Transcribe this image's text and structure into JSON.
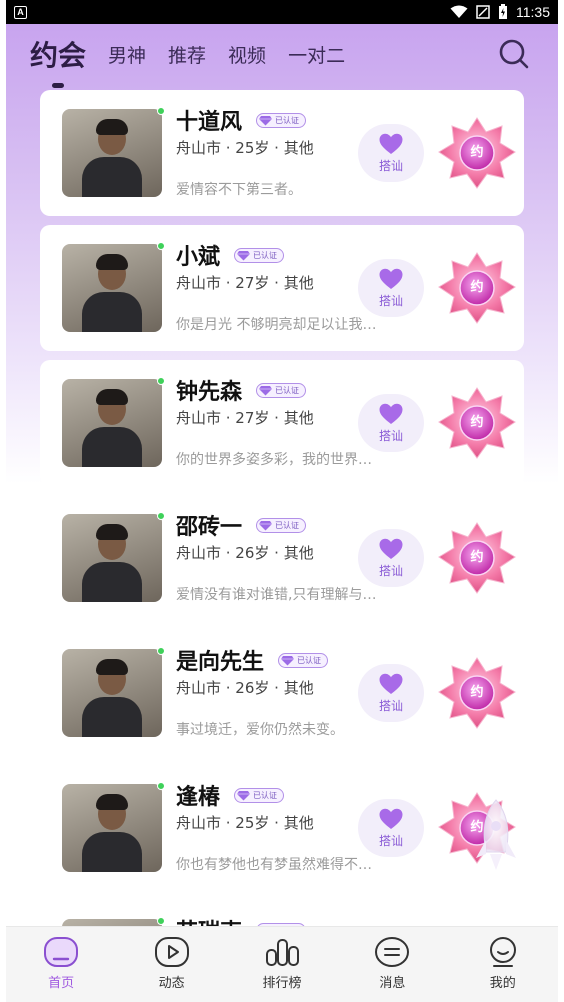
{
  "status_bar": {
    "app_badge": "A",
    "time": "11:35"
  },
  "top_nav": {
    "tabs": [
      {
        "label": "约会",
        "active": true
      },
      {
        "label": "男神",
        "active": false
      },
      {
        "label": "推荐",
        "active": false
      },
      {
        "label": "视频",
        "active": false
      },
      {
        "label": "一对二",
        "active": false
      }
    ],
    "search_icon": "search-icon"
  },
  "cards": [
    {
      "name": "十道风",
      "verified_label": "已认证",
      "meta": "舟山市 · 25岁 · 其他",
      "bio": "爱情容不下第三者。",
      "greet_label": "搭讪",
      "date_label": "约",
      "online": true
    },
    {
      "name": "小斌",
      "verified_label": "已认证",
      "meta": "舟山市 · 27岁 · 其他",
      "bio": "你是月光 不够明亮却足以让我…",
      "greet_label": "搭讪",
      "date_label": "约",
      "online": true
    },
    {
      "name": "钟先森",
      "verified_label": "已认证",
      "meta": "舟山市 · 27岁 · 其他",
      "bio": "你的世界多姿多彩，我的世界…",
      "greet_label": "搭讪",
      "date_label": "约",
      "online": true
    },
    {
      "name": "邵砖一",
      "verified_label": "已认证",
      "meta": "舟山市 · 26岁 · 其他",
      "bio": "爱情没有谁对谁错,只有理解与…",
      "greet_label": "搭讪",
      "date_label": "约",
      "online": true
    },
    {
      "name": "是向先生",
      "verified_label": "已认证",
      "meta": "舟山市 · 26岁 · 其他",
      "bio": "事过境迁，爱你仍然未变。",
      "greet_label": "搭讪",
      "date_label": "约",
      "online": true
    },
    {
      "name": "逢椿",
      "verified_label": "已认证",
      "meta": "舟山市 · 25岁 · 其他",
      "bio": "你也有梦他也有梦虽然难得不…",
      "greet_label": "搭讪",
      "date_label": "约",
      "online": true
    },
    {
      "name": "艾瑞克",
      "verified_label": "已认证",
      "meta": "",
      "bio": "",
      "greet_label": "",
      "date_label": "",
      "online": true
    }
  ],
  "bottom_nav": [
    {
      "label": "首页",
      "icon": "home-icon",
      "active": true
    },
    {
      "label": "动态",
      "icon": "play-icon",
      "active": false
    },
    {
      "label": "排行榜",
      "icon": "ranking-icon",
      "active": false
    },
    {
      "label": "消息",
      "icon": "message-icon",
      "active": false
    },
    {
      "label": "我的",
      "icon": "profile-icon",
      "active": false
    }
  ],
  "colors": {
    "accent": "#a05ae0",
    "hero_top": "#c8a4ef",
    "online": "#3fd15a"
  }
}
